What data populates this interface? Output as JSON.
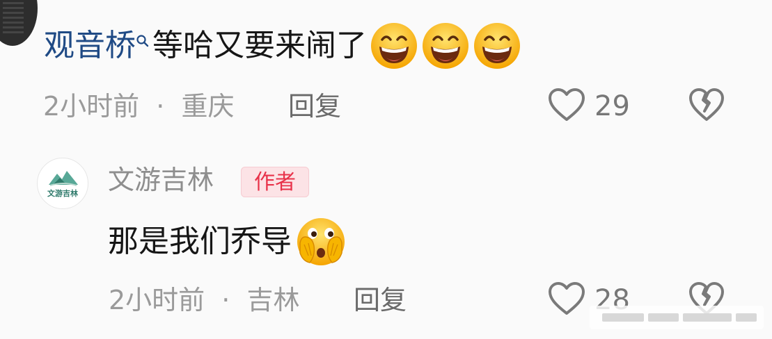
{
  "comments": [
    {
      "username": "观音桥",
      "text": "等哈又要来闹了",
      "emojis": [
        "grin-emoji",
        "grin-emoji",
        "grin-emoji"
      ],
      "time": "2小时前",
      "separator": "·",
      "location": "重庆",
      "reply_label": "回复",
      "likes": "29"
    },
    {
      "username": "文游吉林",
      "avatar_text": "文游吉林",
      "badge": "作者",
      "text": "那是我们乔导",
      "emojis": [
        "peeking-face-emoji"
      ],
      "time": "2小时前",
      "separator": "·",
      "location": "吉林",
      "reply_label": "回复",
      "likes": "28"
    }
  ],
  "colors": {
    "username_link": "#1f4a85",
    "badge_bg": "#fce3e6",
    "badge_text": "#e8324a",
    "meta_text": "#9a9a9a",
    "body_text": "#161616",
    "background": "#fafafa"
  },
  "icons": {
    "like": "heart-outline-icon",
    "dislike": "broken-heart-icon",
    "search": "search-icon"
  }
}
